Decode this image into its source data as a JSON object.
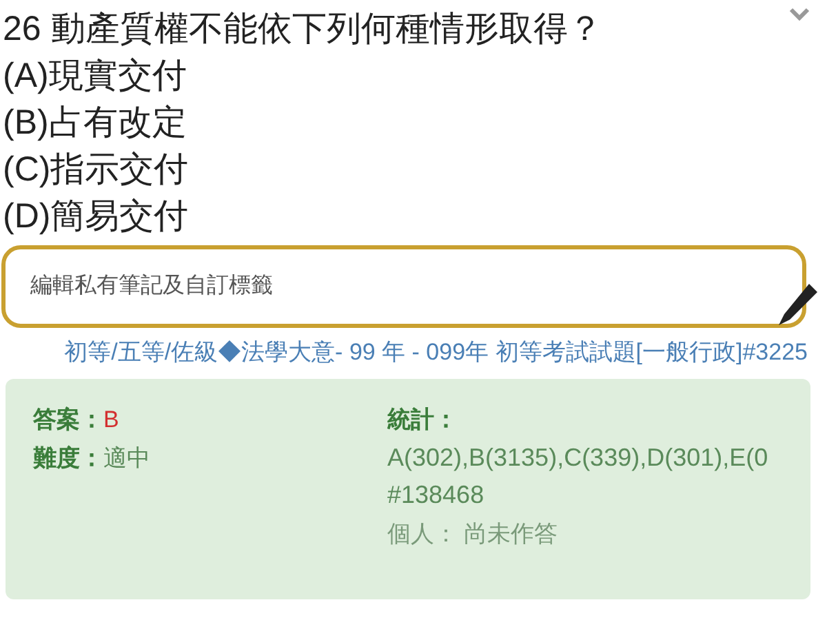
{
  "question": {
    "number": "26",
    "text": "動產質權不能依下列何種情形取得？"
  },
  "options": [
    {
      "label": "(A)",
      "text": "現實交付"
    },
    {
      "label": "(B)",
      "text": "占有改定"
    },
    {
      "label": "(C)",
      "text": "指示交付"
    },
    {
      "label": "(D)",
      "text": "簡易交付"
    }
  ],
  "note_field": {
    "placeholder": "編輯私有筆記及自訂標籤"
  },
  "source_link": "初等/五等/佐級◆法學大意- 99 年 - 099年 初等考試試題[一般行政]#3225",
  "answer_card": {
    "answer_label": "答案：",
    "answer": "B",
    "difficulty_label": "難度：",
    "difficulty": "適中",
    "stats_label": "統計：",
    "stats": "A(302),B(3135),C(339),D(301),E(0",
    "total": "#138468",
    "personal": "個人： 尚未作答"
  }
}
